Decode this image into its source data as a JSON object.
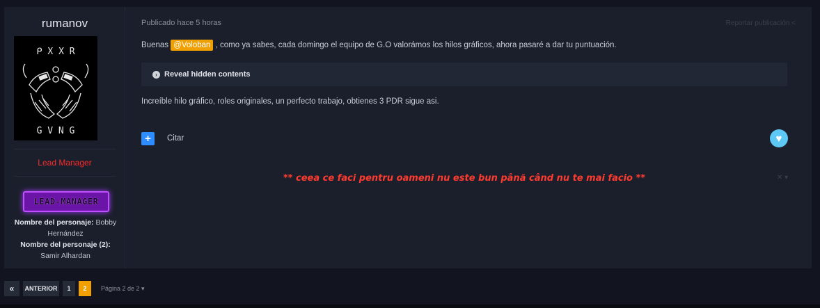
{
  "author": {
    "name": "rumanov",
    "rank": "Lead Manager",
    "badge_text": "LEAD-MANAGER",
    "avatar_text_top": "ᑭ X X R",
    "avatar_text_bottom": "G V N G",
    "fields": [
      {
        "label": "Nombre del personaje:",
        "value": "Bobby Hernández"
      },
      {
        "label": "Nombre del personaje (2):",
        "value": "Samir Alhardan"
      }
    ]
  },
  "post": {
    "meta": "Publicado hace 5 horas",
    "body_before": "Buenas ",
    "mention": "@Voloban",
    "body_after": " , como ya sabes, cada domingo el equipo de G.O valorámos los hilos gráficos, ahora pasaré a dar tu puntuación.",
    "spoiler_label": "Reveal hidden contents",
    "body2": "Increíble hilo gráfico, roles originales, un perfecto trabajo, obtienes 3 PDR sigue asi.",
    "quote_label": "Citar",
    "quote_icon": "+",
    "share_text": "Reportar publicación  <",
    "signature": "** ceea ce faci pentru oameni nu este bun până când nu te mai facio **",
    "signature_toggle": "✕ ▾"
  },
  "pagination": {
    "first": "«",
    "prev": "ANTERIOR",
    "pages": [
      "1",
      "2"
    ],
    "active_page": "2",
    "info": "Página 2 de 2 ▾"
  },
  "colors": {
    "accent": "#f0a000",
    "rank": "#ff2a2a",
    "quote": "#2d8cff",
    "reaction": "#5ec8f5",
    "online": "#1ec31e"
  },
  "icons": {
    "spoiler": "chevron-right-circle-icon",
    "reaction": "heart-icon",
    "quote": "plus-icon"
  }
}
